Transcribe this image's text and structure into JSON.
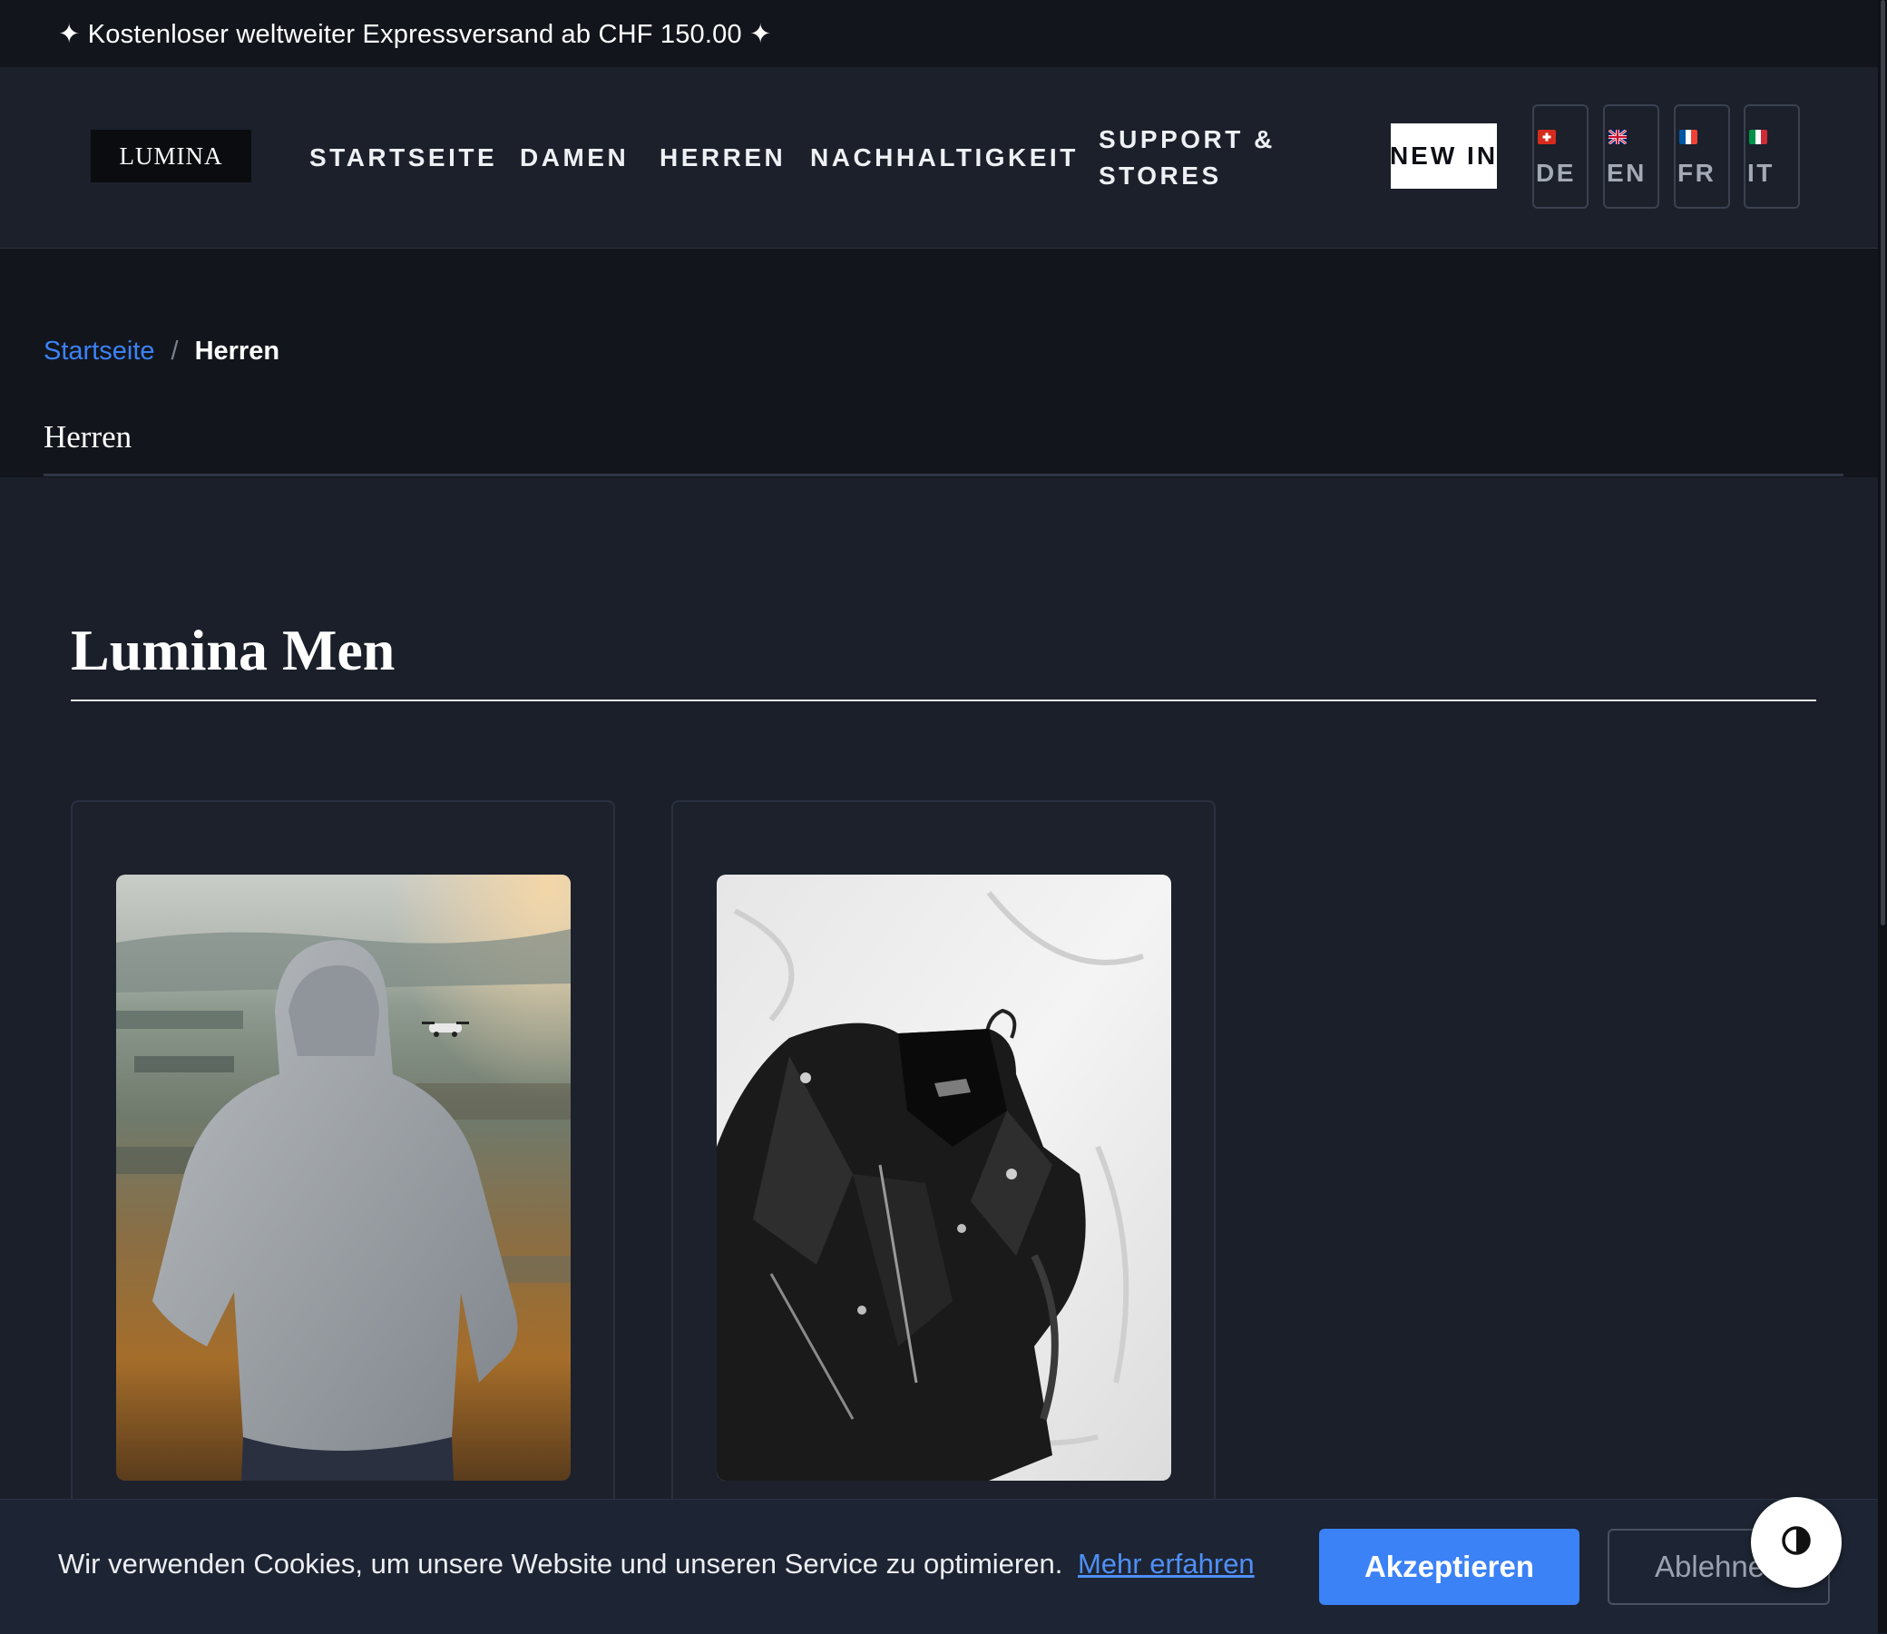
{
  "announcement": {
    "text": "✦ Kostenloser weltweiter Expressversand ab CHF 150.00 ✦"
  },
  "header": {
    "logo": "LUMINA",
    "nav": [
      {
        "label": "STARTSEITE"
      },
      {
        "label": "DAMEN"
      },
      {
        "label": "HERREN"
      },
      {
        "label": "NACHHALTIGKEIT"
      },
      {
        "label_line1": "SUPPORT &",
        "label_line2": "STORES"
      }
    ],
    "new_in": "NEW IN",
    "languages": [
      {
        "code": "DE",
        "flag": "flag-ch-icon"
      },
      {
        "code": "EN",
        "flag": "flag-gb-icon"
      },
      {
        "code": "FR",
        "flag": "flag-fr-icon"
      },
      {
        "code": "IT",
        "flag": "flag-it-icon"
      }
    ]
  },
  "breadcrumb": {
    "home": "Startseite",
    "separator": "/",
    "current": "Herren"
  },
  "page": {
    "title": "Herren",
    "section_title": "Lumina Men"
  },
  "products": [
    {
      "image": "man-in-grey-hoodie-photo"
    },
    {
      "image": "black-leather-jacket-photo"
    }
  ],
  "cookie_banner": {
    "text": "Wir verwenden Cookies, um unsere Website und unseren Service zu optimieren.",
    "link": "Mehr erfahren",
    "accept": "Akzeptieren",
    "decline": "Ablehnen"
  },
  "colors": {
    "background": "#1a1f2a",
    "accent": "#3b82f6",
    "topbar": "#12151c"
  }
}
